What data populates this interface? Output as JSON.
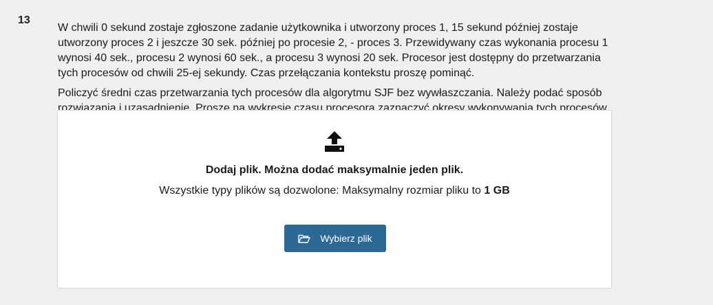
{
  "question": {
    "number": "13",
    "paragraphs": [
      "W chwili 0 sekund zostaje zgłoszone zadanie użytkownika i utworzony proces 1, 15 sekund później zostaje utworzony proces 2 i jeszcze 30 sek. później po procesie 2, -  proces 3. Przewidywany czas wykonania procesu 1 wynosi 40 sek., procesu 2 wynosi 60 sek., a procesu 3 wynosi 20 sek. Procesor jest dostępny do przetwarzania tych procesów od chwili 25-ej sekundy. Czas przełączania kontekstu proszę pominąć.",
      "Policzyć średni czas przetwarzania tych procesów dla algorytmu SJF bez wywłaszczania. Należy podać sposób rozwiązania i uzasadnienie. Proszę na wykresie czasu procesora zaznaczyć okresy wykonywania tych procesów."
    ]
  },
  "upload": {
    "icon": "upload-icon",
    "title": "Dodaj plik. Można dodać maksymalnie jeden plik.",
    "info_prefix": "Wszystkie typy plików są dozwolone: Maksymalny rozmiar pliku to ",
    "info_size": "1 GB",
    "button_icon": "folder-open-icon",
    "button_label": "Wybierz plik"
  },
  "colors": {
    "background": "#efefef",
    "button": "#2e6894"
  }
}
